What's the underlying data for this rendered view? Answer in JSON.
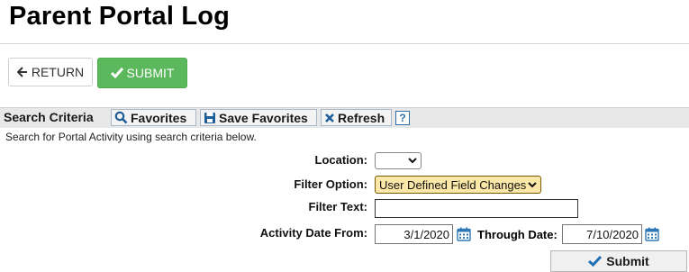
{
  "page": {
    "title": "Parent Portal Log"
  },
  "actions": {
    "return_label": "RETURN",
    "submit_label": "SUBMIT"
  },
  "toolbar": {
    "label": "Search Criteria",
    "favorites_label": "Favorites",
    "save_favorites_label": "Save Favorites",
    "refresh_label": "Refresh",
    "help_label": "?"
  },
  "instructions": "Search for Portal Activity using search criteria below.",
  "form": {
    "location_label": "Location:",
    "location_value": "",
    "filter_option_label": "Filter Option:",
    "filter_option_value": "User Defined Field Changes",
    "filter_text_label": "Filter Text:",
    "filter_text_value": "",
    "activity_date_from_label": "Activity Date From:",
    "activity_date_from_value": "3/1/2020",
    "through_date_label": "Through Date:",
    "through_date_value": "7/10/2020",
    "submit_label": "Submit"
  },
  "colors": {
    "submit_green": "#5cb85c",
    "filter_highlight": "#fbe7a7",
    "icon_blue": "#1f5f99",
    "calendar_blue": "#2f78b7"
  },
  "icons": {
    "return": "arrow-left-icon",
    "submit": "checkmark-icon",
    "favorites": "search-icon",
    "save_favorites": "floppy-disk-icon",
    "refresh": "close-x-icon",
    "help": "help-icon",
    "calendar": "calendar-icon",
    "dropdown": "chevron-down-icon"
  }
}
